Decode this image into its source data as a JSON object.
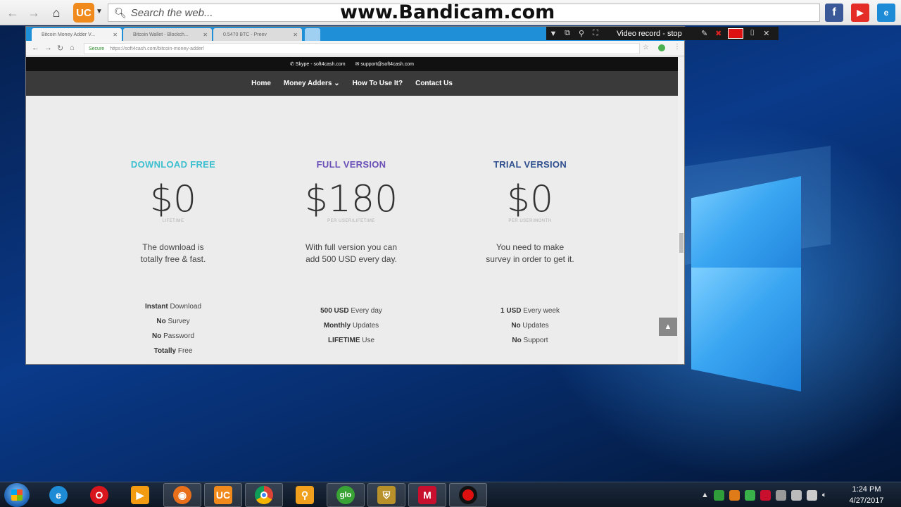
{
  "toolbar": {
    "search_placeholder": "Search the web..."
  },
  "watermark": "www.Bandicam.com",
  "bandicam": {
    "label": "Video record - stop"
  },
  "chrome": {
    "tabs": [
      {
        "label": "Bitcoin Money Adder V..."
      },
      {
        "label": "Bitcoin Wallet - Blockch..."
      },
      {
        "label": "0.5470 BTC - Preev"
      }
    ],
    "address": {
      "secure": "Secure",
      "url": "https://soft4cash.com/bitcoin-money-adder/"
    }
  },
  "site": {
    "skype": "Skype - soft4cash.com",
    "email": "support@soft4cash.com",
    "nav": [
      "Home",
      "Money Adders",
      "How To Use It?",
      "Contact Us"
    ],
    "plans": [
      {
        "title": "DOWNLOAD FREE",
        "price": "$0",
        "period": "LIFETIME",
        "desc_1": "The download is",
        "desc_2": "totally free & fast.",
        "features": [
          {
            "strong": "Instant",
            "rest": " Download"
          },
          {
            "strong": "No",
            "rest": " Survey"
          },
          {
            "strong": "No",
            "rest": " Password"
          },
          {
            "strong": "Totally",
            "rest": " Free"
          }
        ]
      },
      {
        "title": "FULL VERSION",
        "price": "$180",
        "period": "PER USER/LIFETIME",
        "desc_1": "With full version you can",
        "desc_2": "add 500 USD every day.",
        "features": [
          {
            "strong": "500 USD",
            "rest": " Every day"
          },
          {
            "strong": "Monthly",
            "rest": " Updates"
          },
          {
            "strong": "LIFETIME",
            "rest": " Use"
          }
        ]
      },
      {
        "title": "TRIAL VERSION",
        "price": "$0",
        "period": "PER USER/MONTH",
        "desc_1": "You need to make",
        "desc_2": "survey in order to get it.",
        "features": [
          {
            "strong": "1 USD",
            "rest": " Every week"
          },
          {
            "strong": "No",
            "rest": " Updates"
          },
          {
            "strong": "No",
            "rest": " Support"
          }
        ]
      }
    ]
  },
  "colors": {
    "plan_1_title": "#3bbfcf",
    "plan_2_title": "#6a4fb6",
    "plan_3_title": "#2f4f8f"
  },
  "taskbar": {
    "time": "1:24 PM",
    "date": "4/27/2017",
    "apps": [
      "internet-explorer",
      "opera",
      "media-player",
      "firefox",
      "uc-browser",
      "chrome",
      "search-app",
      "glo",
      "shield-app",
      "mcafee",
      "bandicam"
    ]
  }
}
